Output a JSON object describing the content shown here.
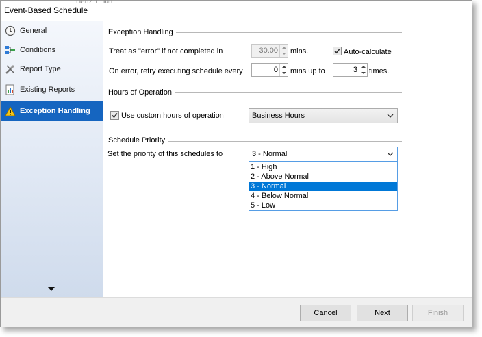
{
  "window": {
    "title": "Event-Based Schedule",
    "ghost_text": "Hertz + Hutt"
  },
  "sidebar": {
    "items": [
      {
        "label": "General",
        "icon": "clock-icon"
      },
      {
        "label": "Conditions",
        "icon": "conditions-icon"
      },
      {
        "label": "Report Type",
        "icon": "tools-icon"
      },
      {
        "label": "Existing Reports",
        "icon": "report-icon"
      },
      {
        "label": "Exception Handling",
        "icon": "warning-icon",
        "active": true
      }
    ]
  },
  "exception_handling": {
    "title": "Exception Handling",
    "treat_label": "Treat as \"error\" if not completed in",
    "treat_value": "30.00",
    "mins_label": "mins.",
    "auto_calc_label": "Auto-calculate",
    "auto_calc_checked": true,
    "retry_label": "On error, retry  executing schedule every",
    "retry_value": "0",
    "mins_up_to_label": "mins up to",
    "times_value": "3",
    "times_label": "times."
  },
  "hours": {
    "title": "Hours of Operation",
    "custom_label": "Use custom hours of operation",
    "custom_checked": true,
    "selected": "Business Hours"
  },
  "priority": {
    "title": "Schedule Priority",
    "label": "Set the priority of this schedules to",
    "selected": "3 - Normal",
    "options": [
      "1 - High",
      "2 - Above Normal",
      "3 - Normal",
      "4 - Below Normal",
      "5 - Low"
    ],
    "highlighted_index": 2
  },
  "footer": {
    "cancel_prefix": "",
    "cancel_key": "C",
    "cancel_rest": "ancel",
    "next_key": "N",
    "next_rest": "ext",
    "finish_key": "F",
    "finish_rest": "inish"
  },
  "colors": {
    "accent": "#1565c0",
    "selection": "#0078d7"
  }
}
